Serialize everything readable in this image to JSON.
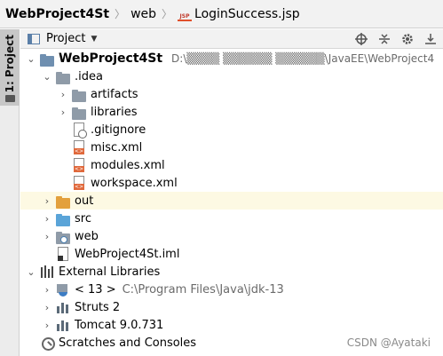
{
  "breadcrumb": {
    "items": [
      {
        "label": "WebProject4St",
        "bold": true
      },
      {
        "label": "web",
        "bold": false
      },
      {
        "label": "LoginSuccess.jsp",
        "bold": false
      }
    ],
    "jsp_icon_text": "JSP"
  },
  "side_strip": {
    "tab_label": "1: Project"
  },
  "panel_header": {
    "title": "Project",
    "icons": [
      "locate-icon",
      "collapse-all-icon",
      "gear-icon",
      "hide-icon"
    ]
  },
  "tree": {
    "rows": [
      {
        "label": "WebProject4St",
        "bold": true,
        "arrow": "expanded",
        "icon": "module-folder",
        "path": "D:\\▒▒▒▒ ▒▒▒▒▒▒ ▒▒▒▒▒▒\\JavaEE\\WebProject4"
      },
      {
        "label": ".idea",
        "arrow": "expanded",
        "icon": "folder"
      },
      {
        "label": "artifacts",
        "arrow": "collapsed",
        "icon": "folder"
      },
      {
        "label": "libraries",
        "arrow": "collapsed",
        "icon": "folder"
      },
      {
        "label": ".gitignore",
        "arrow": "none",
        "icon": "gitignore-file"
      },
      {
        "label": "misc.xml",
        "arrow": "none",
        "icon": "xml-file"
      },
      {
        "label": "modules.xml",
        "arrow": "none",
        "icon": "xml-file"
      },
      {
        "label": "workspace.xml",
        "arrow": "none",
        "icon": "xml-file"
      },
      {
        "label": "out",
        "arrow": "collapsed",
        "icon": "excluded-folder",
        "highlight": true
      },
      {
        "label": "src",
        "arrow": "collapsed",
        "icon": "source-folder"
      },
      {
        "label": "web",
        "arrow": "collapsed",
        "icon": "web-folder"
      },
      {
        "label": "WebProject4St.iml",
        "arrow": "none",
        "icon": "iml-file"
      },
      {
        "label": "External Libraries",
        "arrow": "expanded",
        "icon": "libraries"
      },
      {
        "label": "< 13 >",
        "arrow": "collapsed",
        "icon": "jdk",
        "path": "C:\\Program Files\\Java\\jdk-13"
      },
      {
        "label": "Struts 2",
        "arrow": "collapsed",
        "icon": "library-bars"
      },
      {
        "label": "Tomcat 9.0.731",
        "arrow": "collapsed",
        "icon": "library-bars"
      },
      {
        "label": "Scratches and Consoles",
        "arrow": "none",
        "icon": "scratches"
      }
    ]
  },
  "watermark": "CSDN @Ayataki"
}
